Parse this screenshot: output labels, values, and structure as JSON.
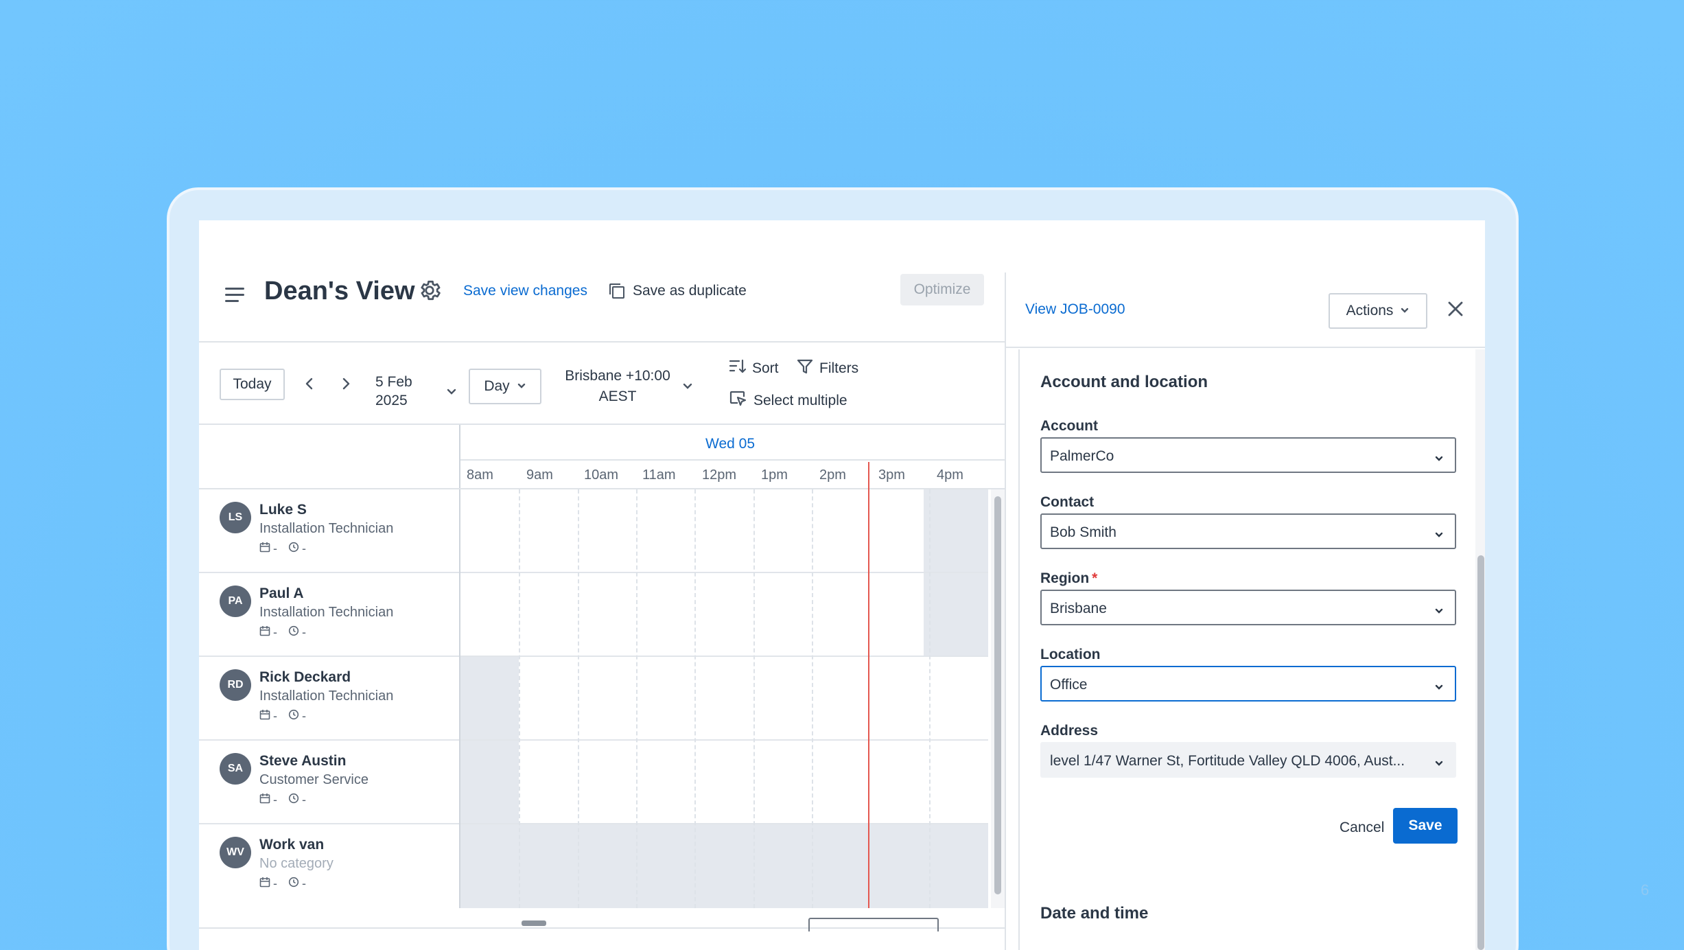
{
  "page_number": "6",
  "header": {
    "view_title": "Dean's View",
    "save_view_label": "Save view changes",
    "save_duplicate_label": "Save as duplicate",
    "optimize_label": "Optimize"
  },
  "controls": {
    "today_label": "Today",
    "date_line1": "5 Feb",
    "date_line2": "2025",
    "view_mode": "Day",
    "timezone_line1": "Brisbane +10:00",
    "timezone_line2": "AEST",
    "sort_label": "Sort",
    "filters_label": "Filters",
    "select_multiple_label": "Select multiple"
  },
  "schedule": {
    "day_label": "Wed 05",
    "hours": [
      "8am",
      "9am",
      "10am",
      "11am",
      "12pm",
      "1pm",
      "2pm",
      "3pm",
      "4pm"
    ],
    "resources": [
      {
        "initials": "LS",
        "name": "Luke S",
        "role": "Installation Technician",
        "jobs": "-",
        "hours": "-"
      },
      {
        "initials": "PA",
        "name": "Paul A",
        "role": "Installation Technician",
        "jobs": "-",
        "hours": "-"
      },
      {
        "initials": "RD",
        "name": "Rick Deckard",
        "role": "Installation Technician",
        "jobs": "-",
        "hours": "-"
      },
      {
        "initials": "SA",
        "name": "Steve Austin",
        "role": "Customer Service",
        "jobs": "-",
        "hours": "-"
      },
      {
        "initials": "WV",
        "name": "Work van",
        "role": "No category",
        "jobs": "-",
        "hours": "-"
      }
    ]
  },
  "panel": {
    "view_job_label": "View JOB-0090",
    "actions_label": "Actions",
    "section_title": "Account and location",
    "account_label": "Account",
    "account_value": "PalmerCo",
    "contact_label": "Contact",
    "contact_value": "Bob Smith",
    "region_label": "Region",
    "region_required": "*",
    "region_value": "Brisbane",
    "location_label": "Location",
    "location_value": "Office",
    "address_label": "Address",
    "address_value": "level 1/47 Warner St, Fortitude Valley QLD 4006, Aust...",
    "cancel_label": "Cancel",
    "save_label": "Save",
    "next_section_title": "Date and time"
  },
  "colors": {
    "accent": "#0a6bd1",
    "now_line": "#e4574f",
    "background": "#6ec3fd",
    "unavailable": "#e4e8ee"
  }
}
